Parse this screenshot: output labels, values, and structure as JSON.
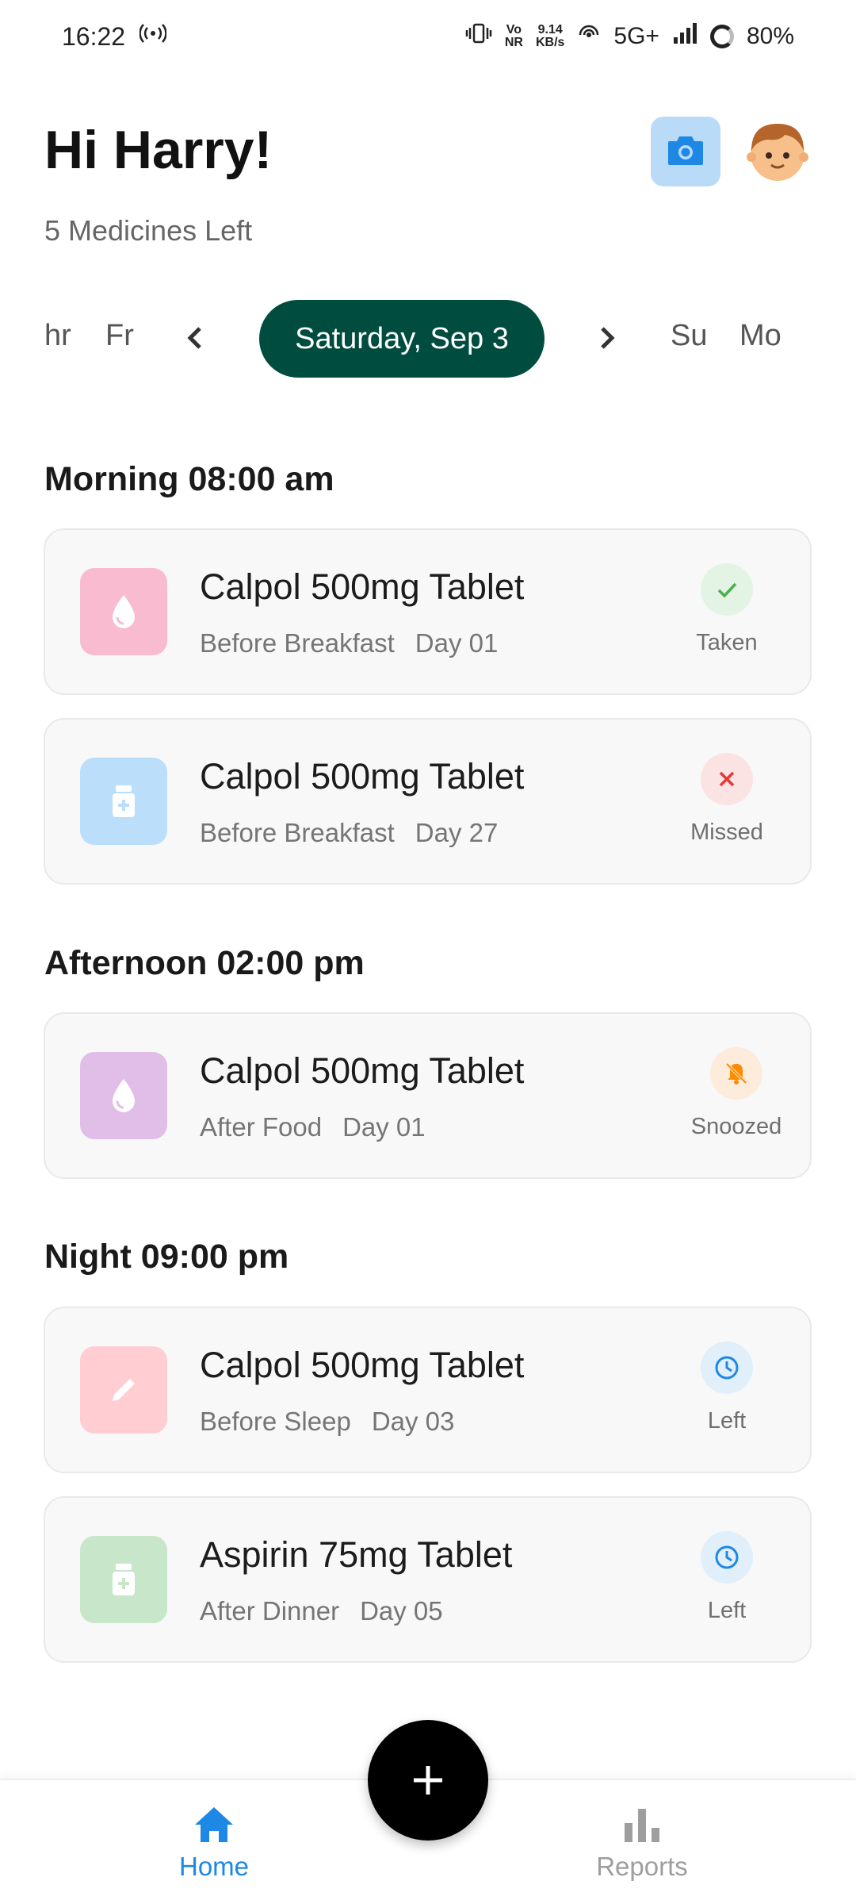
{
  "status_bar": {
    "time": "16:22",
    "vo_top": "Vo",
    "vo_bottom": "NR",
    "speed_top": "9.14",
    "speed_bottom": "KB/s",
    "network": "5G+",
    "battery": "80%"
  },
  "header": {
    "greeting": "Hi Harry!",
    "subtitle": "5 Medicines Left"
  },
  "date_strip": {
    "days_left": [
      "hr",
      "Fr"
    ],
    "selected": "Saturday, Sep 3",
    "days_right": [
      "Su",
      "Mo"
    ]
  },
  "sections": [
    {
      "title": "Morning 08:00 am",
      "items": [
        {
          "name": "Calpol 500mg Tablet",
          "instruction": "Before Breakfast",
          "day": "Day 01",
          "status": "Taken",
          "icon": "drop-icon",
          "icon_bg": "#f8bbd0",
          "status_icon": "check-icon"
        },
        {
          "name": "Calpol 500mg Tablet",
          "instruction": "Before Breakfast",
          "day": "Day 27",
          "status": "Missed",
          "icon": "pill-bottle-icon",
          "icon_bg": "#bbdefb",
          "status_icon": "cross-icon"
        }
      ]
    },
    {
      "title": "Afternoon 02:00 pm",
      "items": [
        {
          "name": "Calpol 500mg Tablet",
          "instruction": "After Food",
          "day": "Day 01",
          "status": "Snoozed",
          "icon": "drop-icon",
          "icon_bg": "#e1bee7",
          "status_icon": "bell-off-icon"
        }
      ]
    },
    {
      "title": "Night 09:00 pm",
      "items": [
        {
          "name": "Calpol 500mg Tablet",
          "instruction": "Before Sleep",
          "day": "Day 03",
          "status": "Left",
          "icon": "pencil-icon",
          "icon_bg": "#ffcdd2",
          "status_icon": "clock-icon"
        },
        {
          "name": "Aspirin 75mg Tablet",
          "instruction": "After Dinner",
          "day": "Day 05",
          "status": "Left",
          "icon": "pill-bottle-icon",
          "icon_bg": "#c8e6c9",
          "status_icon": "clock-icon"
        }
      ]
    }
  ],
  "nav": {
    "home": "Home",
    "reports": "Reports",
    "active_color": "#1e88e5",
    "inactive_color": "#9e9e9e"
  },
  "colors": {
    "accent": "#004d40",
    "taken": "#4caf50",
    "missed": "#e53935",
    "snoozed": "#fb8c00",
    "left": "#1e88e5"
  }
}
